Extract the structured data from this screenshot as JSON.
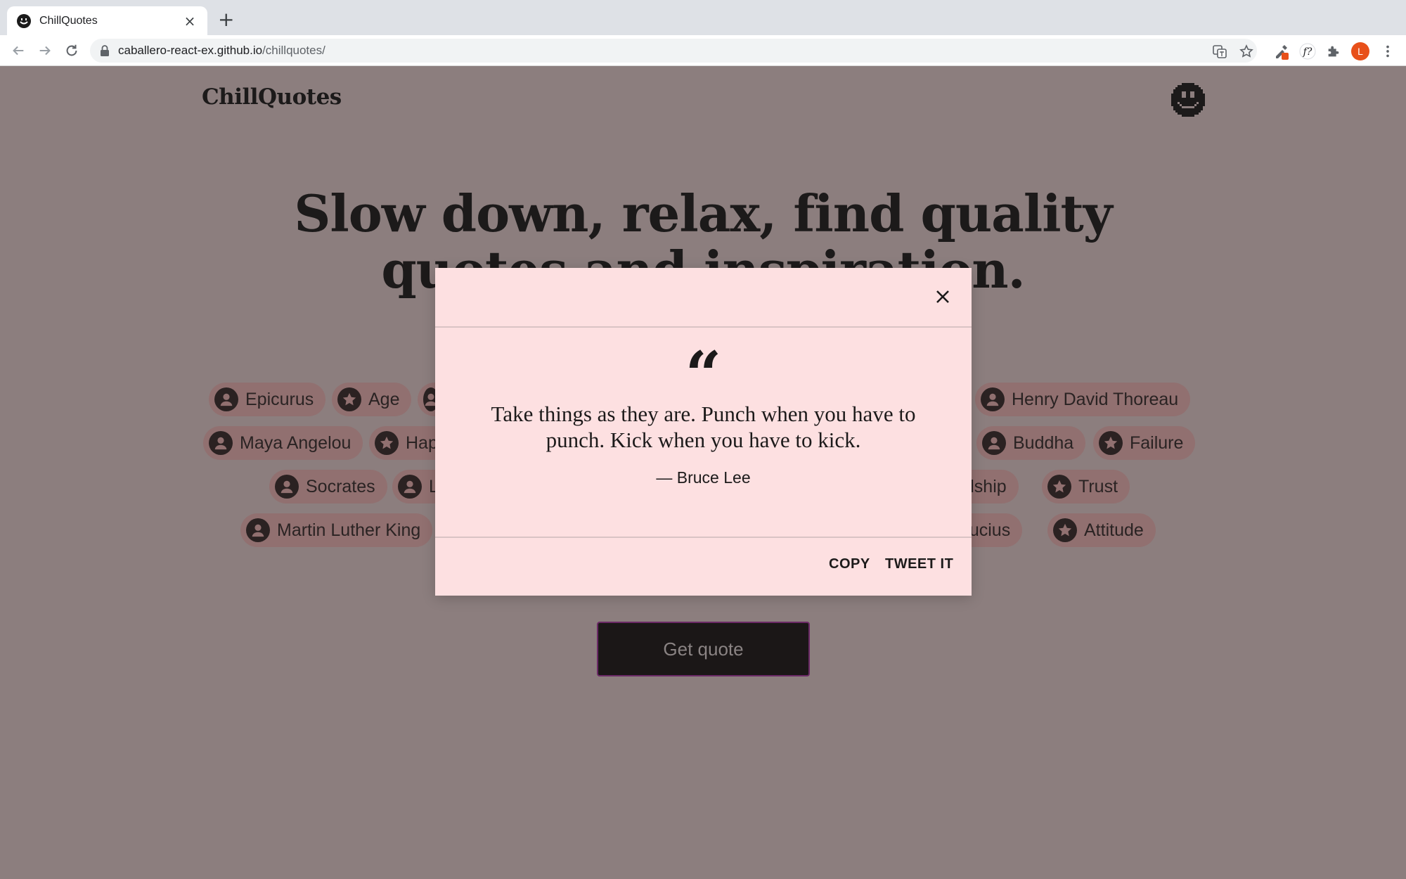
{
  "browser": {
    "tab_title": "ChillQuotes",
    "tab_close": "×",
    "new_tab": "+",
    "url_host": "caballero-react-ex.github.io",
    "url_path": "/chillquotes/",
    "avatar_letter": "L"
  },
  "site": {
    "brand": "ChillQuotes",
    "headline": "Slow down, relax, find quality quotes and inspiration."
  },
  "chips": [
    {
      "label": "Epicurus",
      "icon": "person-icon"
    },
    {
      "label": "Age",
      "icon": "star-icon"
    },
    {
      "label": "Henry David Thoreau",
      "icon": "person-icon"
    },
    {
      "label": "Maya Angelou",
      "icon": "person-icon"
    },
    {
      "label": "Hap",
      "icon": "star-icon"
    },
    {
      "label": "Buddha",
      "icon": "person-icon"
    },
    {
      "label": "Failure",
      "icon": "star-icon"
    },
    {
      "label": "Socrates",
      "icon": "person-icon"
    },
    {
      "label": "L",
      "icon": "person-icon"
    },
    {
      "label": "ndship",
      "icon": "star-icon"
    },
    {
      "label": "Trust",
      "icon": "star-icon"
    },
    {
      "label": "Martin Luther King",
      "icon": "person-icon"
    },
    {
      "label": "nfucius",
      "icon": "person-icon"
    },
    {
      "label": "Attitude",
      "icon": "star-icon"
    }
  ],
  "get_quote_label": "Get quote",
  "modal": {
    "quote_mark": "“",
    "quote": "Take things as they are. Punch when you have to punch. Kick when you have to kick.",
    "author": "— Bruce Lee",
    "copy_label": "COPY",
    "tweet_label": "TWEET IT"
  },
  "colors": {
    "page_bg": "#8c7e7e",
    "modal_bg": "#fde0e1",
    "chip_bg": "#917070",
    "button_bg": "#1b1717"
  }
}
